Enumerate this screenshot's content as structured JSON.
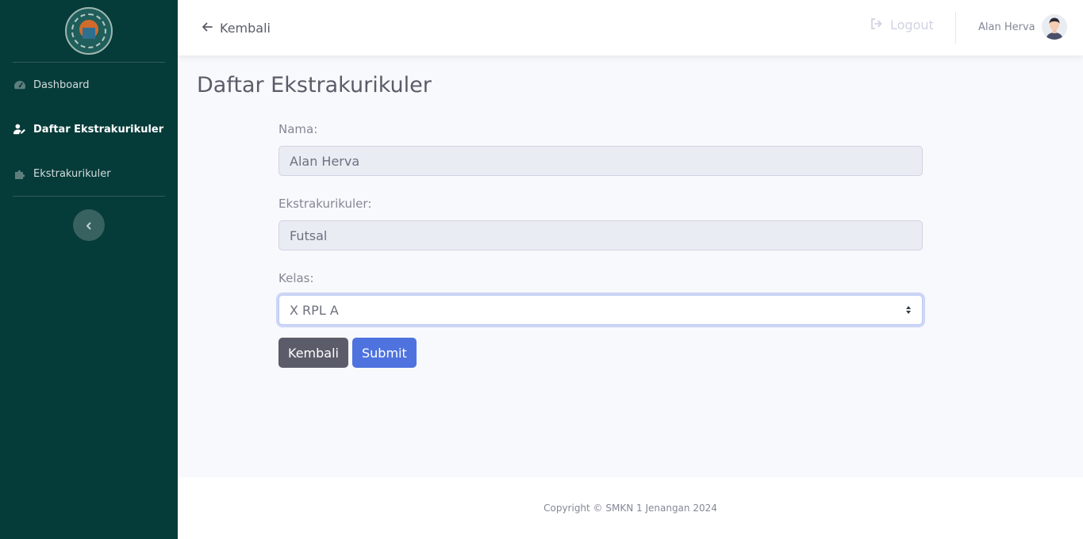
{
  "sidebar": {
    "logo_name": "school-logo",
    "items": [
      {
        "label": "Dashboard",
        "icon": "tachometer-icon",
        "active": false
      },
      {
        "label": "Daftar Ekstrakurikuler",
        "icon": "user-edit-icon",
        "active": true
      },
      {
        "label": "Ekstrakurikuler",
        "icon": "puzzle-icon",
        "active": false
      }
    ],
    "toggle_icon": "chevron-left-icon"
  },
  "topbar": {
    "back_label": "Kembali",
    "logout_label": "Logout",
    "user_name": "Alan Herva"
  },
  "main": {
    "title": "Daftar Ekstrakurikuler",
    "form": {
      "nama_label": "Nama:",
      "nama_value": "Alan Herva",
      "ekskul_label": "Ekstrakurikuler:",
      "ekskul_value": "Futsal",
      "kelas_label": "Kelas:",
      "kelas_value": "X RPL A",
      "back_button": "Kembali",
      "submit_button": "Submit"
    }
  },
  "footer": {
    "copyright": "Copyright © SMKN 1 Jenangan 2024"
  },
  "colors": {
    "sidebar_bg": "#053b39",
    "primary": "#4e73df",
    "secondary": "#5a5c69"
  }
}
